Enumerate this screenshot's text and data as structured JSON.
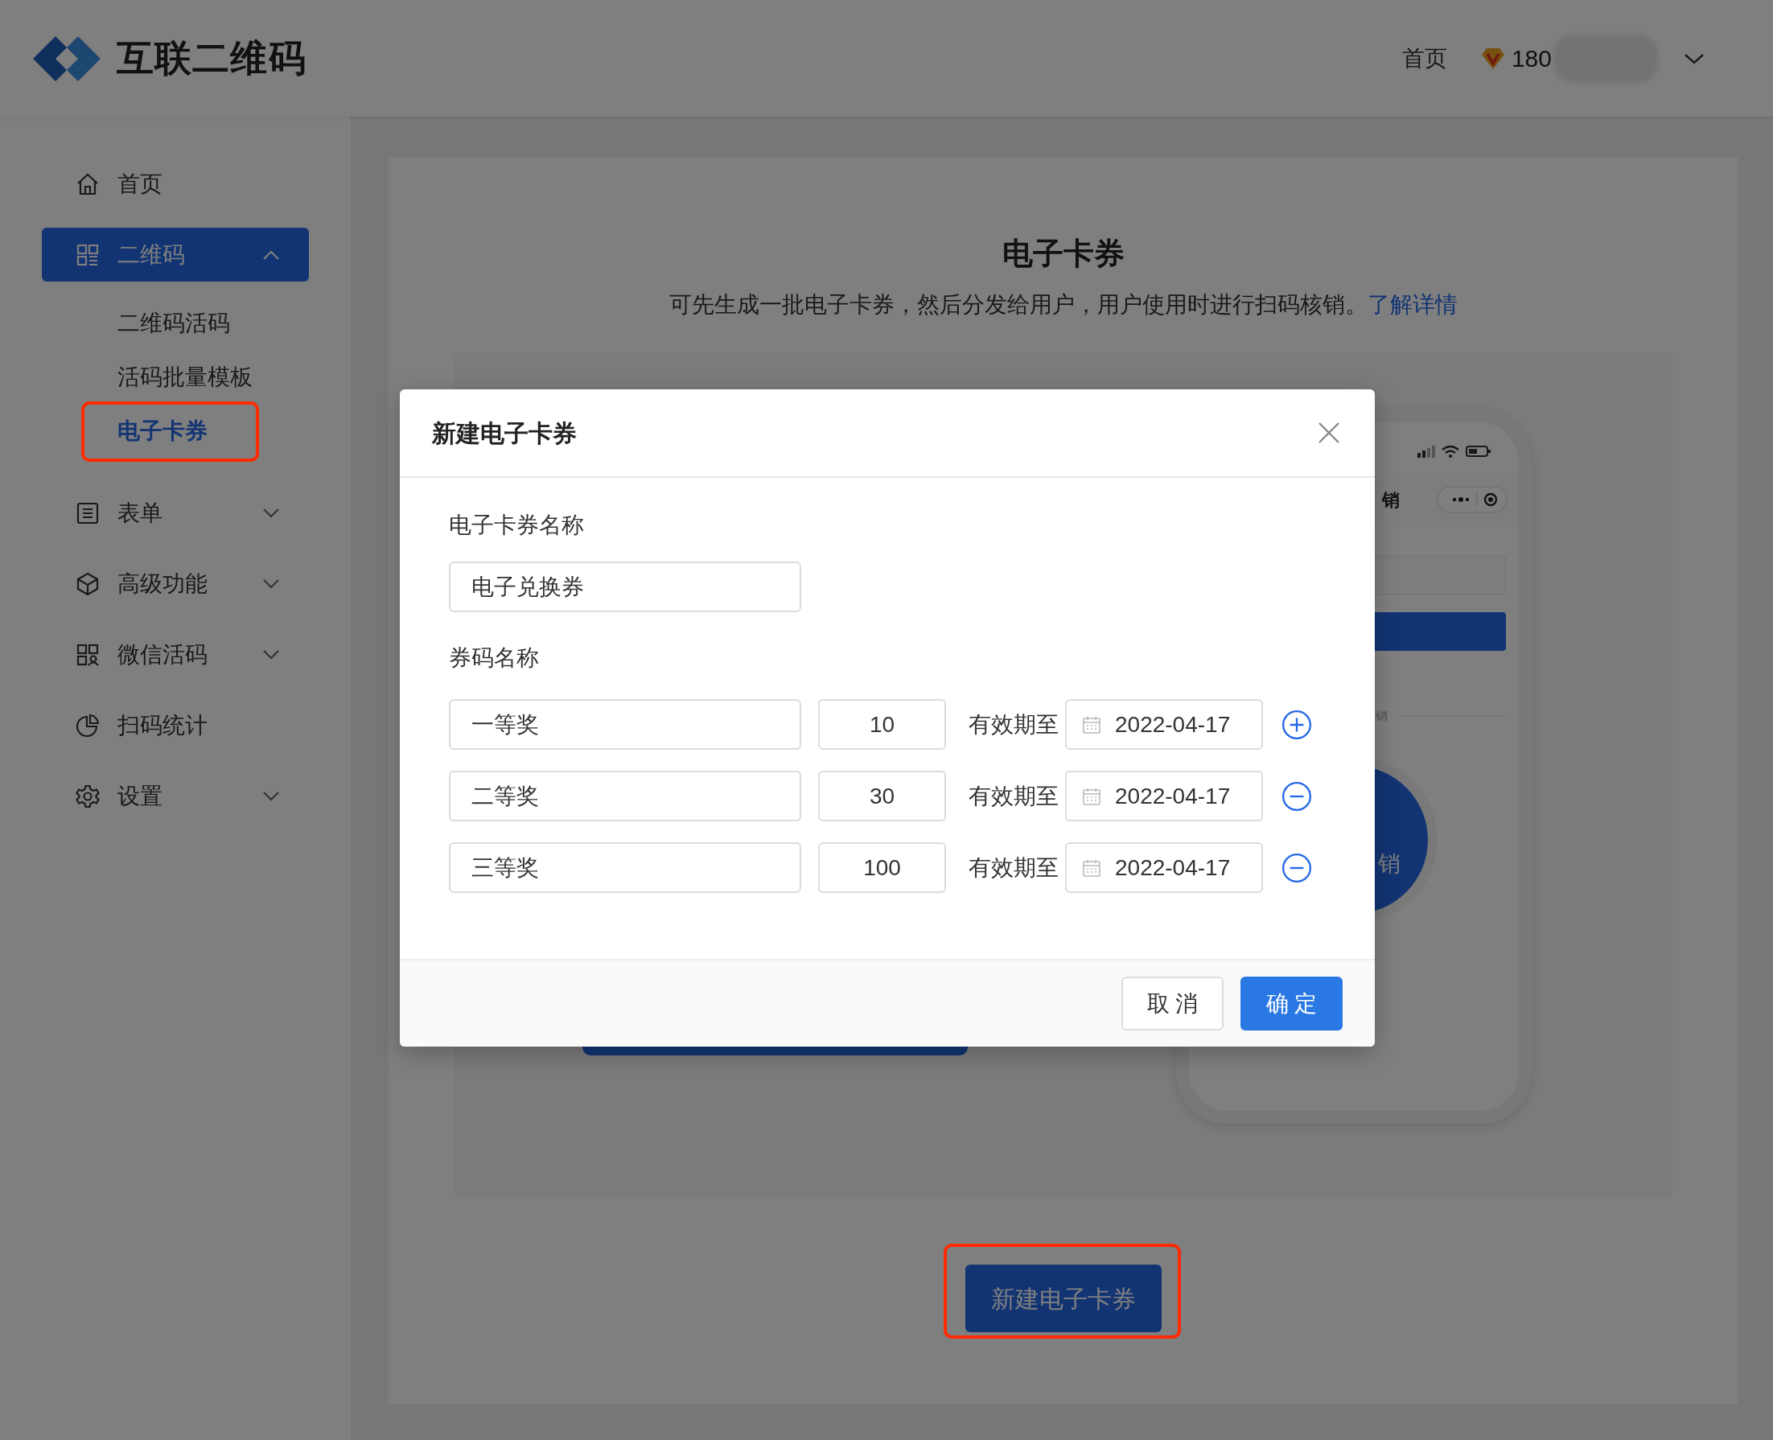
{
  "header": {
    "logo": "互联二维码",
    "nav_link": "首页",
    "points": "180"
  },
  "sidebar": {
    "items": [
      {
        "kind": "link",
        "label": "首页",
        "selected": false
      },
      {
        "kind": "group",
        "label": "二维码",
        "selected": true,
        "expanded": true,
        "children": [
          {
            "label": "二维码活码",
            "selected": false,
            "highlighted": false
          },
          {
            "label": "活码批量模板",
            "selected": false,
            "highlighted": false
          },
          {
            "label": "电子卡券",
            "selected": true,
            "highlighted": true
          }
        ]
      },
      {
        "kind": "group",
        "label": "表单",
        "selected": false,
        "expanded": false
      },
      {
        "kind": "group",
        "label": "高级功能",
        "selected": false,
        "expanded": false
      },
      {
        "kind": "group",
        "label": "微信活码",
        "selected": false,
        "expanded": false
      },
      {
        "kind": "link",
        "label": "扫码统计",
        "selected": false
      },
      {
        "kind": "group",
        "label": "设置",
        "selected": false,
        "expanded": false
      }
    ]
  },
  "main": {
    "title": "电子卡券",
    "description": "可先生成一批电子卡券，然后分发给用户，用户使用时进行扫码核销。",
    "link": "了解详情",
    "preview": {
      "nav_title": "销",
      "divider_label": "销",
      "action_label": "销"
    },
    "create_button": {
      "label": "新建电子卡券",
      "highlighted": true
    }
  },
  "modal": {
    "title": "新建电子卡券",
    "name_label": "电子卡券名称",
    "name_value": "电子兑换券",
    "codes_label": "券码名称",
    "rows": [
      {
        "name": "一等奖",
        "count": "10",
        "expiry_label": "有效期至",
        "date": "2022-04-17",
        "kind": "add"
      },
      {
        "name": "二等奖",
        "count": "30",
        "expiry_label": "有效期至",
        "date": "2022-04-17",
        "kind": "remove"
      },
      {
        "name": "三等奖",
        "count": "100",
        "expiry_label": "有效期至",
        "date": "2022-04-17",
        "kind": "remove"
      }
    ],
    "buttons": [
      {
        "label": "取 消",
        "kind": "secondary"
      },
      {
        "label": "确 定",
        "kind": "primary"
      }
    ]
  }
}
